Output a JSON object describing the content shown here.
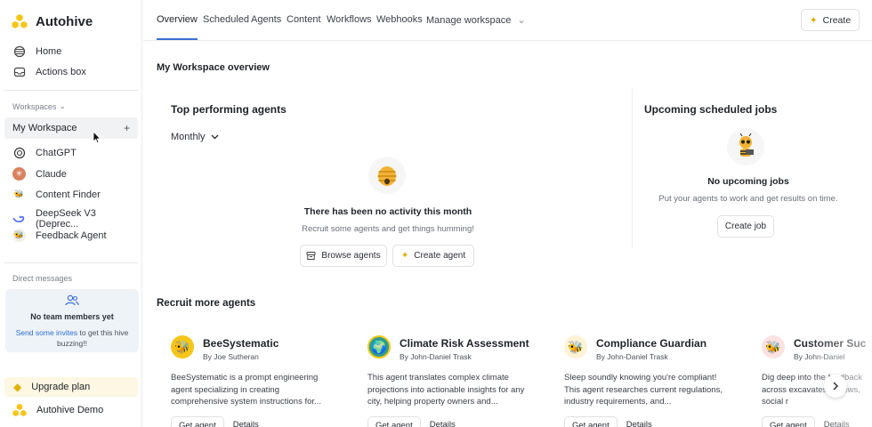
{
  "brand": {
    "name": "Autohive",
    "accent": "#f5c518"
  },
  "sidebar": {
    "nav": [
      {
        "label": "Home",
        "icon": "home-icon"
      },
      {
        "label": "Actions box",
        "icon": "inbox-icon"
      }
    ],
    "workspaces_label": "Workspaces",
    "current_workspace": "My Workspace",
    "agents": [
      {
        "label": "ChatGPT",
        "icon": "openai-icon"
      },
      {
        "label": "Claude",
        "icon": "claude-icon"
      },
      {
        "label": "Content Finder",
        "icon": "bee-icon"
      },
      {
        "label": "DeepSeek V3 (Deprec...",
        "icon": "deepseek-icon"
      },
      {
        "label": "Feedback Agent",
        "icon": "bee-icon"
      }
    ],
    "direct_messages_label": "Direct messages",
    "dm": {
      "title": "No team members yet",
      "link": "Send some invites",
      "text": " to get this hive buzzing!!"
    },
    "upgrade": "Upgrade plan",
    "demo": "Autohive Demo"
  },
  "topnav": {
    "tabs": [
      "Overview",
      "Scheduled",
      "Agents",
      "Content",
      "Workflows",
      "Webhooks",
      "Manage workspace"
    ],
    "create": "Create"
  },
  "overview": {
    "title": "My Workspace overview",
    "top_agents": {
      "title": "Top performing agents",
      "period": "Monthly",
      "empty_title": "There has been no activity this month",
      "empty_sub": "Recruit some agents and get things humming!",
      "browse": "Browse agents",
      "create": "Create agent"
    },
    "scheduled": {
      "title": "Upcoming scheduled jobs",
      "empty_title": "No upcoming jobs",
      "empty_sub": "Put your agents to work and get results on time.",
      "create": "Create job"
    }
  },
  "recruit": {
    "title": "Recruit more agents",
    "cards": [
      {
        "name": "BeeSystematic",
        "by": "By Joe Sutheran",
        "desc": "BeeSystematic is a prompt engineering agent specializing in creating comprehensive system instructions for...",
        "get": "Get agent",
        "details": "Details",
        "color": "#f5c518"
      },
      {
        "name": "Climate Risk Assessment",
        "by": "By John-Daniel Trask",
        "desc": "This agent translates complex climate projections into actionable insights for any city, helping property owners and...",
        "get": "Get agent",
        "details": "Details",
        "color": "#2a9d8f"
      },
      {
        "name": "Compliance Guardian",
        "by": "By John-Daniel Trask",
        "desc": "Sleep soundly knowing you're compliant! This agent researches current regulations, industry requirements, and...",
        "get": "Get agent",
        "details": "Details",
        "color": "#e9a23b"
      },
      {
        "name": "Customer Suc",
        "by": "By John-Daniel",
        "desc": "Dig deep into the feedback across excavates reviews, social r",
        "get": "Get agent",
        "details": "Details",
        "color": "#d84a4a"
      }
    ]
  }
}
